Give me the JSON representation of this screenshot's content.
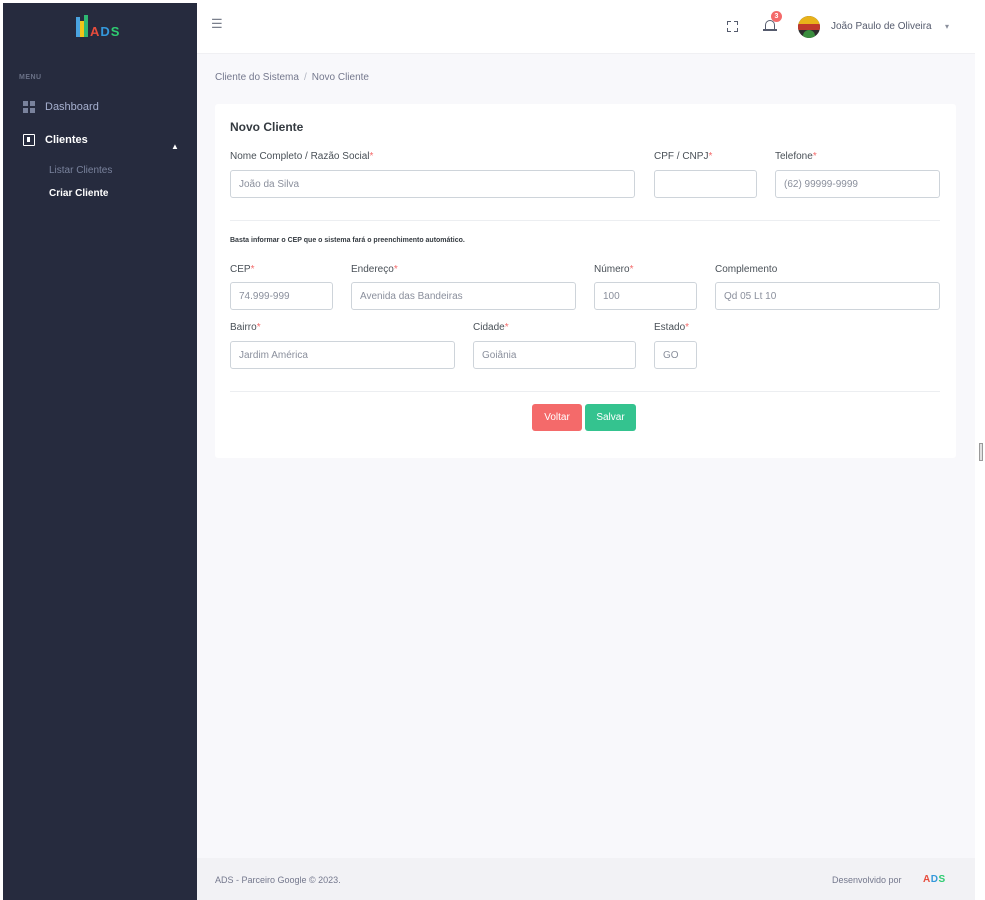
{
  "app": {
    "logo_text": {
      "a": "A",
      "d": "D",
      "s": "S"
    }
  },
  "sidebar": {
    "menu_title": "MENU",
    "items": [
      {
        "label": "Dashboard",
        "icon": "grid-icon"
      },
      {
        "label": "Clientes",
        "icon": "client-icon"
      }
    ],
    "subitems": [
      {
        "label": "Listar Clientes"
      },
      {
        "label": "Criar Cliente"
      }
    ]
  },
  "header": {
    "menu_icon": "☰",
    "notification_count": "3",
    "user_name": "João Paulo de Oliveira"
  },
  "breadcrumb": {
    "parent": "Cliente do Sistema",
    "separator": "/",
    "current": "Novo Cliente"
  },
  "form": {
    "title": "Novo Cliente",
    "required_mark": "*",
    "nome": {
      "label": "Nome Completo / Razão Social",
      "placeholder": "João da Silva"
    },
    "cpf": {
      "label": "CPF / CNPJ",
      "placeholder": ""
    },
    "telefone": {
      "label": "Telefone",
      "placeholder": "(62) 99999-9999"
    },
    "hint": "Basta informar o CEP que o sistema fará o preenchimento automático.",
    "cep": {
      "label": "CEP",
      "placeholder": "74.999-999"
    },
    "endereco": {
      "label": "Endereço",
      "placeholder": "Avenida das Bandeiras"
    },
    "numero": {
      "label": "Número",
      "placeholder": "100"
    },
    "complemento": {
      "label": "Complemento",
      "placeholder": "Qd 05 Lt 10"
    },
    "bairro": {
      "label": "Bairro",
      "placeholder": "Jardim América"
    },
    "cidade": {
      "label": "Cidade",
      "placeholder": "Goiânia"
    },
    "estado": {
      "label": "Estado",
      "placeholder": "GO"
    },
    "buttons": {
      "voltar": "Voltar",
      "salvar": "Salvar"
    }
  },
  "footer": {
    "left": "ADS - Parceiro Google © 2023.",
    "right": "Desenvolvido por"
  }
}
